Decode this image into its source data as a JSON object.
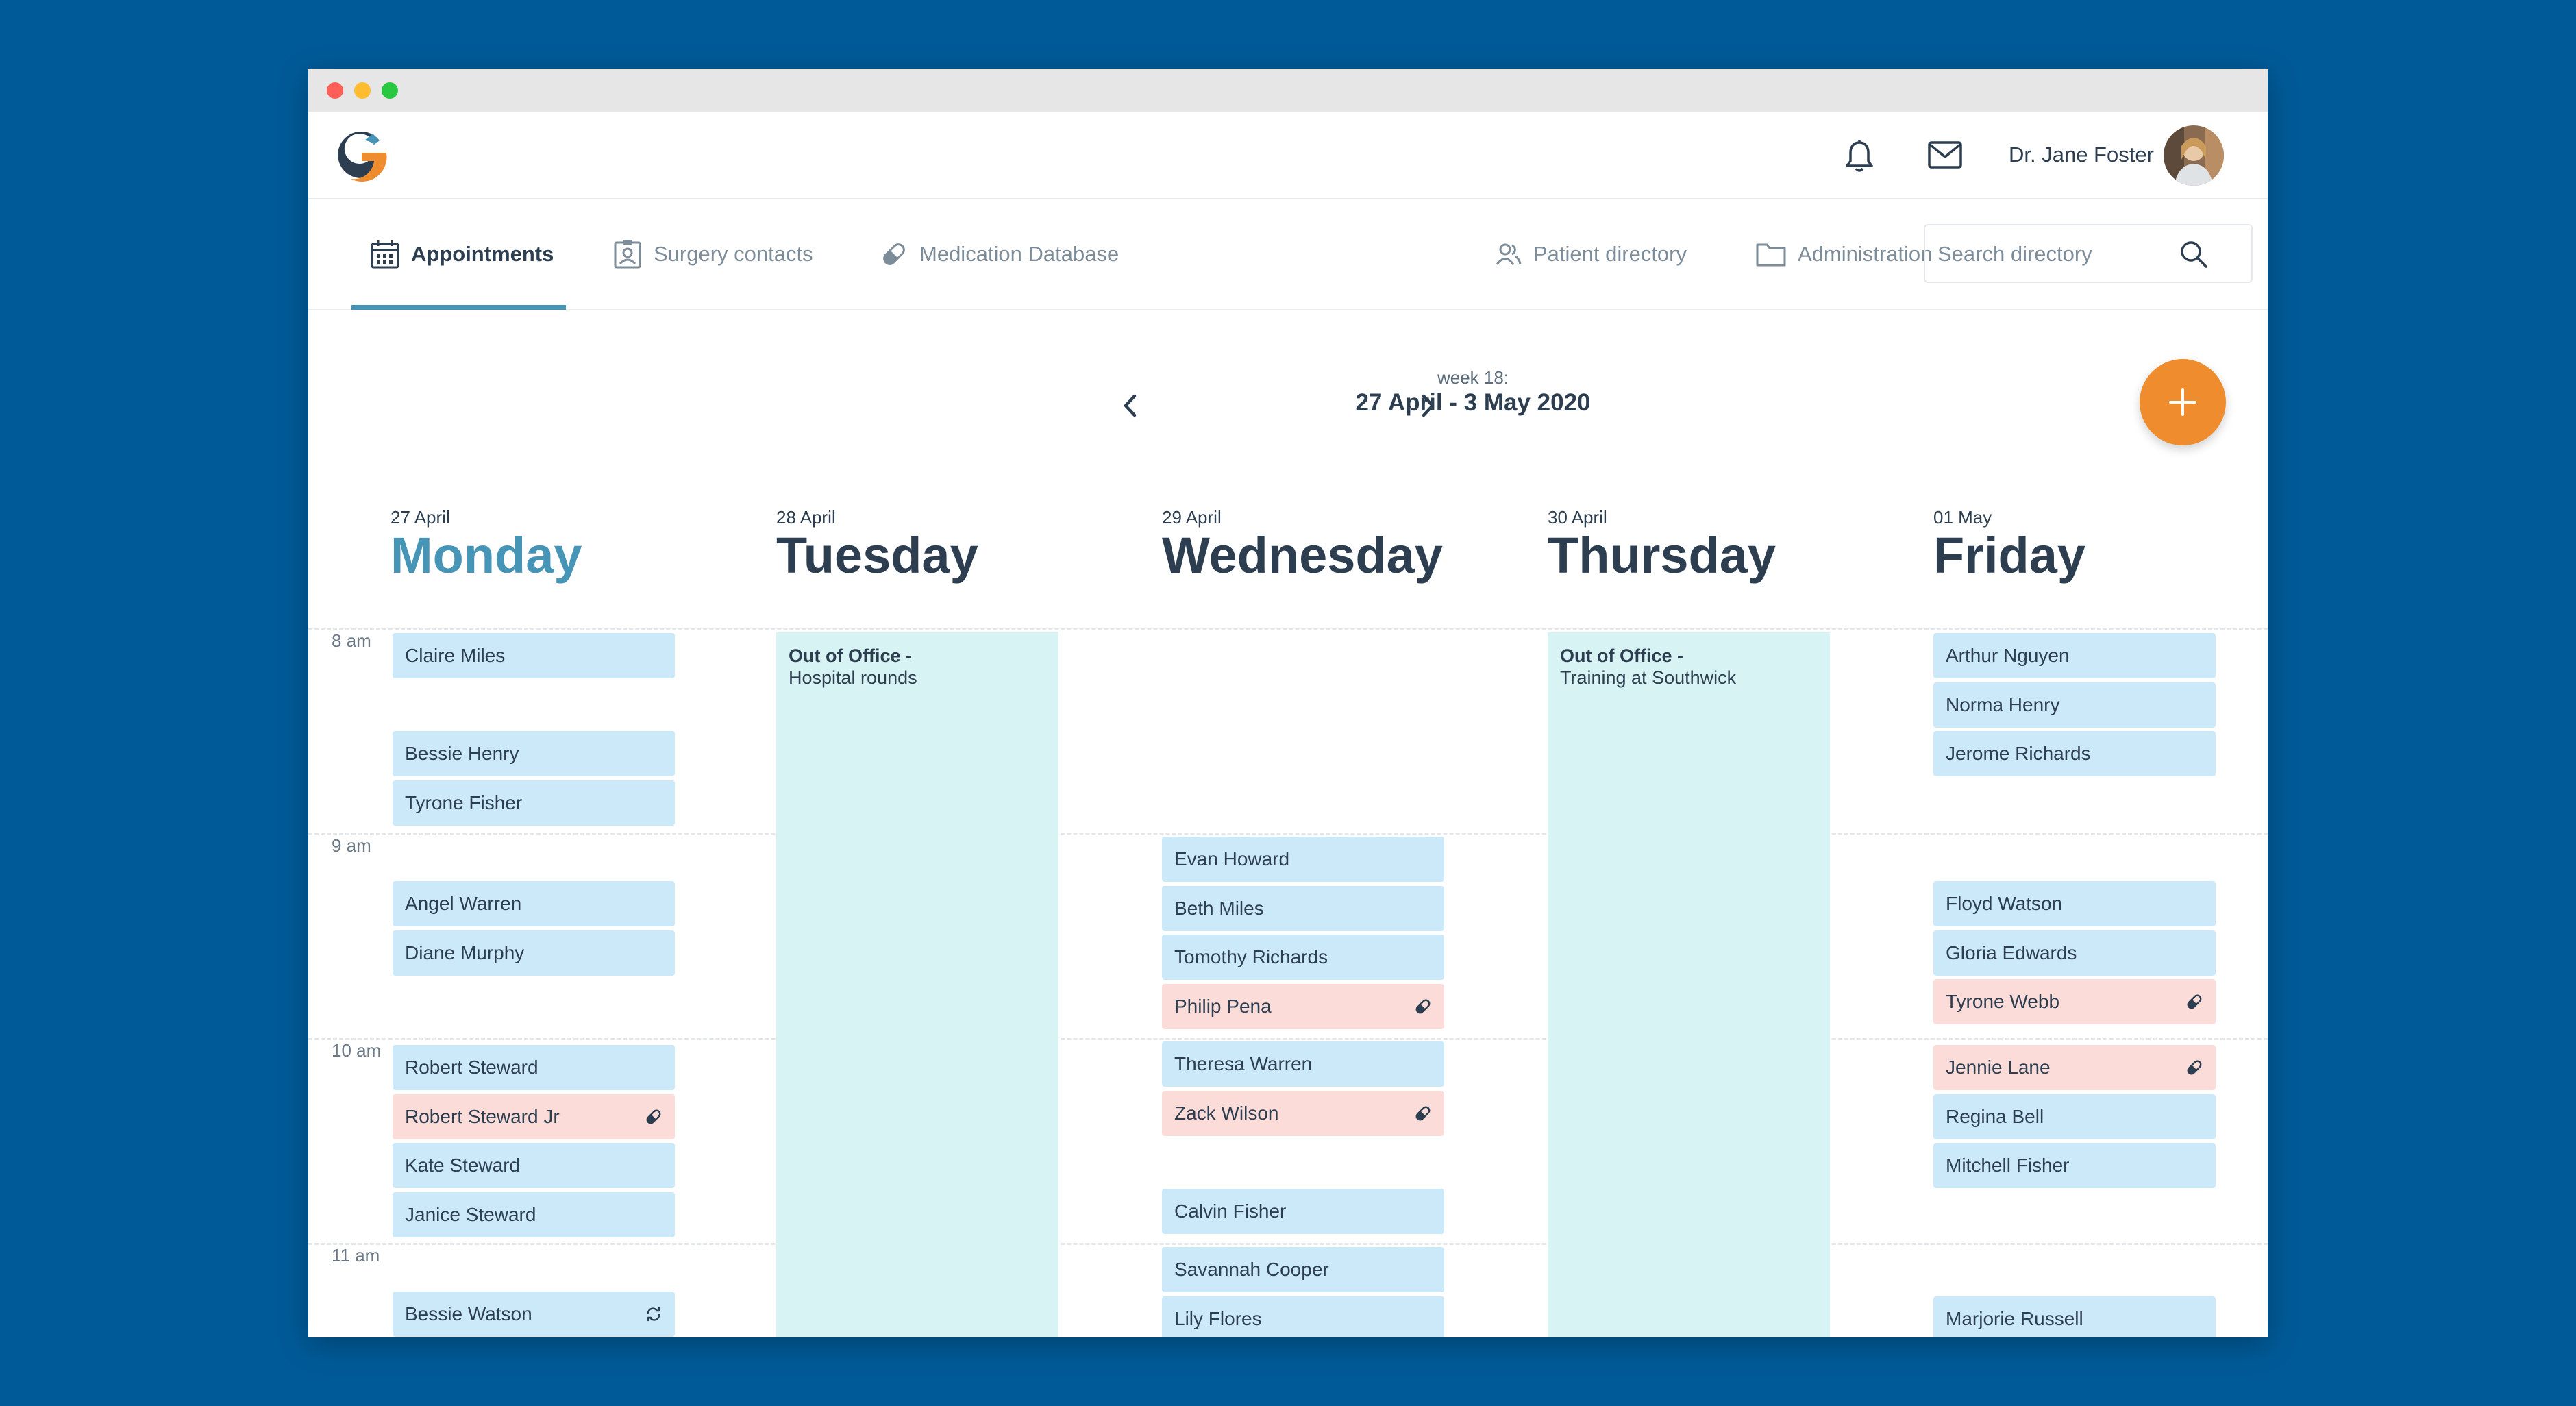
{
  "user": {
    "name": "Dr. Jane Foster"
  },
  "nav": {
    "items": [
      {
        "label": "Appointments"
      },
      {
        "label": "Surgery contacts"
      },
      {
        "label": "Medication Database"
      },
      {
        "label": "Patient directory"
      },
      {
        "label": "Administration"
      }
    ],
    "active": "Appointments"
  },
  "search": {
    "placeholder": "Search directory"
  },
  "week": {
    "label": "week 18:",
    "range": "27 April - 3 May 2020"
  },
  "days": [
    {
      "date": "27 April",
      "name": "Monday",
      "today": true
    },
    {
      "date": "28 April",
      "name": "Tuesday"
    },
    {
      "date": "29 April",
      "name": "Wednesday"
    },
    {
      "date": "30 April",
      "name": "Thursday"
    },
    {
      "date": "01 May",
      "name": "Friday"
    }
  ],
  "hours": [
    "8 am",
    "9 am",
    "10 am",
    "11 am"
  ],
  "out_of_office": {
    "tuesday": {
      "title": "Out of Office -",
      "detail": "Hospital rounds"
    },
    "thursday": {
      "title": "Out of Office -",
      "detail": "Training  at Southwick"
    }
  },
  "appointments": {
    "monday": [
      {
        "name": "Claire Miles",
        "type": "regular"
      },
      {
        "name": "Bessie Henry",
        "type": "regular"
      },
      {
        "name": "Tyrone Fisher",
        "type": "regular"
      },
      {
        "name": "Angel Warren",
        "type": "regular"
      },
      {
        "name": "Diane Murphy",
        "type": "regular"
      },
      {
        "name": "Robert Steward",
        "type": "regular"
      },
      {
        "name": "Robert Steward Jr",
        "type": "medication",
        "icon": "pill-icon"
      },
      {
        "name": "Kate Steward",
        "type": "regular"
      },
      {
        "name": "Janice Steward",
        "type": "regular"
      },
      {
        "name": "Bessie Watson",
        "type": "regular",
        "icon": "recurring-icon"
      }
    ],
    "wednesday": [
      {
        "name": "Evan Howard",
        "type": "regular"
      },
      {
        "name": "Beth Miles",
        "type": "regular"
      },
      {
        "name": "Tomothy Richards",
        "type": "regular"
      },
      {
        "name": "Philip Pena",
        "type": "medication",
        "icon": "pill-icon"
      },
      {
        "name": "Theresa Warren",
        "type": "regular"
      },
      {
        "name": "Zack Wilson",
        "type": "medication",
        "icon": "pill-icon"
      },
      {
        "name": "Calvin Fisher",
        "type": "regular"
      },
      {
        "name": "Savannah Cooper",
        "type": "regular"
      },
      {
        "name": "Lily Flores",
        "type": "regular"
      }
    ],
    "friday": [
      {
        "name": "Arthur Nguyen",
        "type": "regular"
      },
      {
        "name": "Norma Henry",
        "type": "regular"
      },
      {
        "name": "Jerome Richards",
        "type": "regular"
      },
      {
        "name": "Floyd Watson",
        "type": "regular"
      },
      {
        "name": "Gloria Edwards",
        "type": "regular"
      },
      {
        "name": "Tyrone Webb",
        "type": "medication",
        "icon": "pill-icon"
      },
      {
        "name": "Jennie Lane",
        "type": "medication",
        "icon": "pill-icon"
      },
      {
        "name": "Regina Bell",
        "type": "regular"
      },
      {
        "name": "Mitchell Fisher",
        "type": "regular"
      },
      {
        "name": "Marjorie Russell",
        "type": "regular"
      }
    ]
  },
  "colors": {
    "background": "#005a97",
    "accent": "#4795b6",
    "fab": "#ef8c2d",
    "appointment": "#cce9fa",
    "medication_appointment": "#fcdcd8",
    "out_of_office": "#d8f3f3"
  }
}
